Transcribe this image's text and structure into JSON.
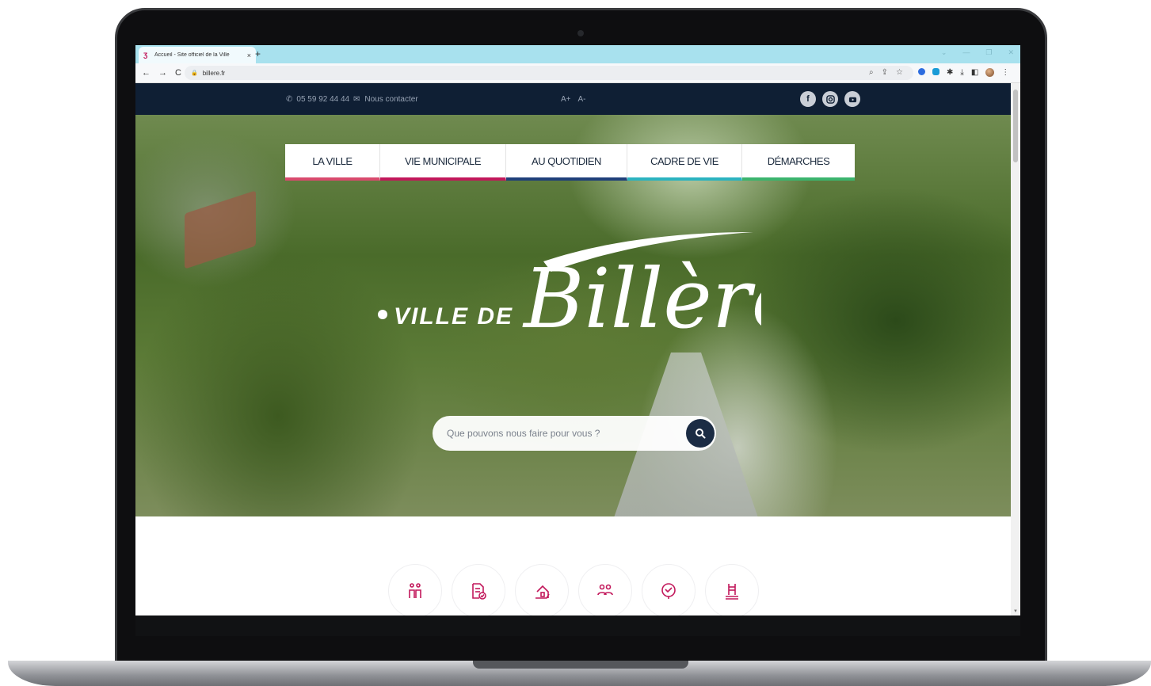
{
  "browser": {
    "tab_title": "Accueil - Site officiel de la Ville",
    "tab_close": "×",
    "new_tab": "+",
    "url": "billere.fr",
    "nav_back": "←",
    "nav_forward": "→",
    "nav_reload": "C",
    "menu": "⋮"
  },
  "topbar": {
    "phone": "05 59 92 44 44",
    "contact": "Nous contacter",
    "font_increase": "A+",
    "font_decrease": "A-",
    "socials": [
      "facebook-icon",
      "instagram-icon",
      "youtube-icon"
    ]
  },
  "nav": {
    "items": [
      {
        "label": "LA VILLE",
        "accent": "#d94a6e"
      },
      {
        "label": "VIE MUNICIPALE",
        "accent": "#c2185b"
      },
      {
        "label": "AU QUOTIDIEN",
        "accent": "#1f3f7a"
      },
      {
        "label": "CADRE DE VIE",
        "accent": "#2bb3c0"
      },
      {
        "label": "DÉMARCHES",
        "accent": "#3bb46e"
      }
    ]
  },
  "logo": {
    "prefix": "VILLE DE",
    "name": "Billère"
  },
  "search": {
    "placeholder": "Que pouvons nous faire pour vous ?"
  },
  "quick_access": {
    "icon_color": "#c2185b",
    "icons": [
      "family-icon",
      "document-check-icon",
      "hand-house-icon",
      "community-icon",
      "handshake-icon",
      "pool-ladder-icon"
    ]
  },
  "colors": {
    "topbar_bg": "#0f1f34",
    "brand_pink": "#c2185b"
  }
}
